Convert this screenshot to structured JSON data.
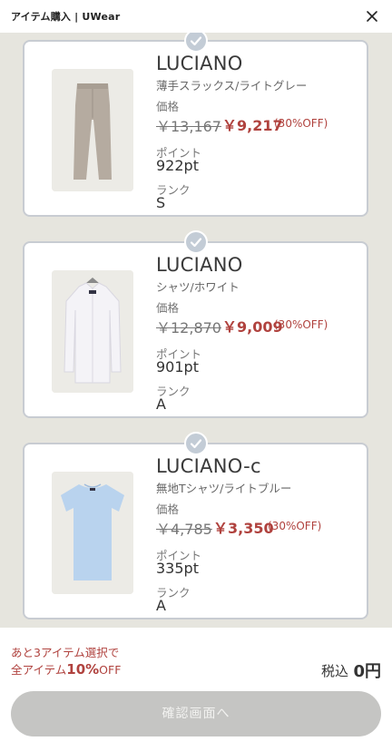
{
  "header": {
    "title": "アイテム購入 | UWear",
    "close_icon": "close-icon"
  },
  "labels": {
    "price": "価格",
    "points": "ポイント",
    "rank": "ランク"
  },
  "items": [
    {
      "brand": "LUCIANO",
      "name": "薄手スラックス/ライトグレー",
      "original_price": "￥13,167",
      "sale_price": "￥9,217",
      "discount": "(30%OFF)",
      "points": "922pt",
      "rank": "S",
      "selected": true,
      "image": "trousers-photo"
    },
    {
      "brand": "LUCIANO",
      "name": "シャツ/ホワイト",
      "original_price": "￥12,870",
      "sale_price": "￥9,009",
      "discount": "(30%OFF)",
      "points": "901pt",
      "rank": "A",
      "selected": true,
      "image": "shirt-photo"
    },
    {
      "brand": "LUCIANO-c",
      "name": "無地Tシャツ/ライトブルー",
      "original_price": "￥4,785",
      "sale_price": "￥3,350",
      "discount": "(30%OFF)",
      "points": "335pt",
      "rank": "A",
      "selected": true,
      "image": "tshirt-photo"
    }
  ],
  "footer": {
    "promo_line1": "あと3アイテム選択で",
    "promo_line2_prefix": "全アイテム",
    "promo_line2_highlight": "10%",
    "promo_line2_suffix": "OFF",
    "total_label": "税込",
    "total_value": "0円",
    "confirm_button": "確認画面へ",
    "confirm_enabled": false
  },
  "colors": {
    "accent": "#b0423e",
    "background": "#e6e5de",
    "card_border": "#c8ccd2",
    "button_disabled": "#c5c5c3"
  }
}
